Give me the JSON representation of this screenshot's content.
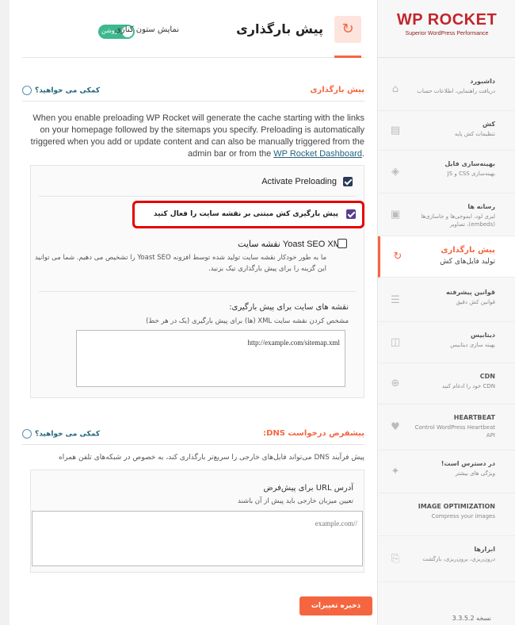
{
  "sidebar": {
    "logo_main": "WP ROCKET",
    "logo_sub": "Superior WordPress Performance",
    "items": [
      {
        "title": "داشبورد",
        "desc": "دریافت راهنمایی، اطلاعات حساب",
        "icon": "home-icon",
        "glyph": "⌂"
      },
      {
        "title": "کش",
        "desc": "تنظیمات کش پایه",
        "icon": "cache-icon",
        "glyph": "▤"
      },
      {
        "title": "بهینه‌سازی فایل",
        "desc": "بهینه‌سازی CSS و JS",
        "icon": "layers-icon",
        "glyph": "◈"
      },
      {
        "title": "رسانه ها",
        "desc": "لیزی لود، ایموجی‌ها و جاسازی‌ها (embeds)، تصاویر",
        "icon": "media-icon",
        "glyph": "▣"
      },
      {
        "title": "پیش بارگذاری",
        "desc": "تولید فایل‌های کش",
        "icon": "refresh-icon",
        "glyph": "↻"
      },
      {
        "title": "قوانین پیشرفته",
        "desc": "قوانین کش دقیق",
        "icon": "list-icon",
        "glyph": "☰"
      },
      {
        "title": "دیتابیس",
        "desc": "بهینه سازی دیتابیس",
        "icon": "database-icon",
        "glyph": "◫"
      },
      {
        "title": "CDN",
        "desc": "CDN خود را ادغام کنید",
        "icon": "cdn-icon",
        "glyph": "⊕"
      },
      {
        "title": "HEARTBEAT",
        "desc": "Control WordPress Heartbeat API",
        "icon": "heart-icon",
        "glyph": "♥"
      },
      {
        "title": "در دسترس است!",
        "desc": "ویژگی های بیشتر",
        "icon": "addons-icon",
        "glyph": "✦"
      },
      {
        "title": "IMAGE OPTIMIZATION",
        "desc": "Compress your images",
        "icon": "image-icon",
        "glyph": ""
      },
      {
        "title": "ابزارها",
        "desc": "درون‌ریزی، برون‌ریزی، بازگشت",
        "icon": "tools-icon",
        "glyph": "⎘"
      }
    ],
    "version_label": "نسخه",
    "version": "3.3.5.2"
  },
  "header": {
    "title": "پیش بارگذاری",
    "toggle_state": "روشن",
    "toggle_label": "نمایش ستون کناری"
  },
  "preload_section": {
    "title": "پیش بارگذاری",
    "help": "کمکی می خواهید؟",
    "description": "When you enable preloading WP Rocket will generate the cache starting with the links on your homepage followed by the sitemaps you specify. Preloading is automatically triggered when you add or update content and can also be manually triggered from the admin bar or from the",
    "description_link": "WP Rocket Dashboard",
    "description_end": ".",
    "activate_label": "Activate Preloading",
    "sitemap_label": "پیش بارگیری کش مبتنی بر نقشه سایت را فعال کنید",
    "yoast_label": "نقشه سایت Yoast SEO XML",
    "yoast_desc": "ما به طور خودکار نقشه سایت تولید شده توسط افزونه Yoast SEO را تشخیص می دهیم. شما می توانید این گزینه را برای پیش بارگذاری تیک بزنید.",
    "sitemaps_field_label": "نقشه های سایت برای پیش بارگیری:",
    "sitemaps_field_sub": "مشخص کردن نقشه سایت XML (ها) برای پیش بارگیری (یک در هر خط)",
    "sitemaps_value": "http://example.com/sitemap.xml"
  },
  "dns_section": {
    "title": "پیشفرض درخواست DNS:",
    "help": "کمکی می خواهید؟",
    "description": "پیش فرآیند DNS می‌تواند فایل‌های خارجی را سریع‌تر بارگذاری کند، به خصوص در شبکه‌های تلفن همراه",
    "field_label": "آدرس URL برای پیش‌فرض",
    "field_sub": "تعیین میزبان خارجی باید پیش از آن باشند",
    "placeholder": "//example.com"
  },
  "save_label": "ذخیره تغییرات"
}
